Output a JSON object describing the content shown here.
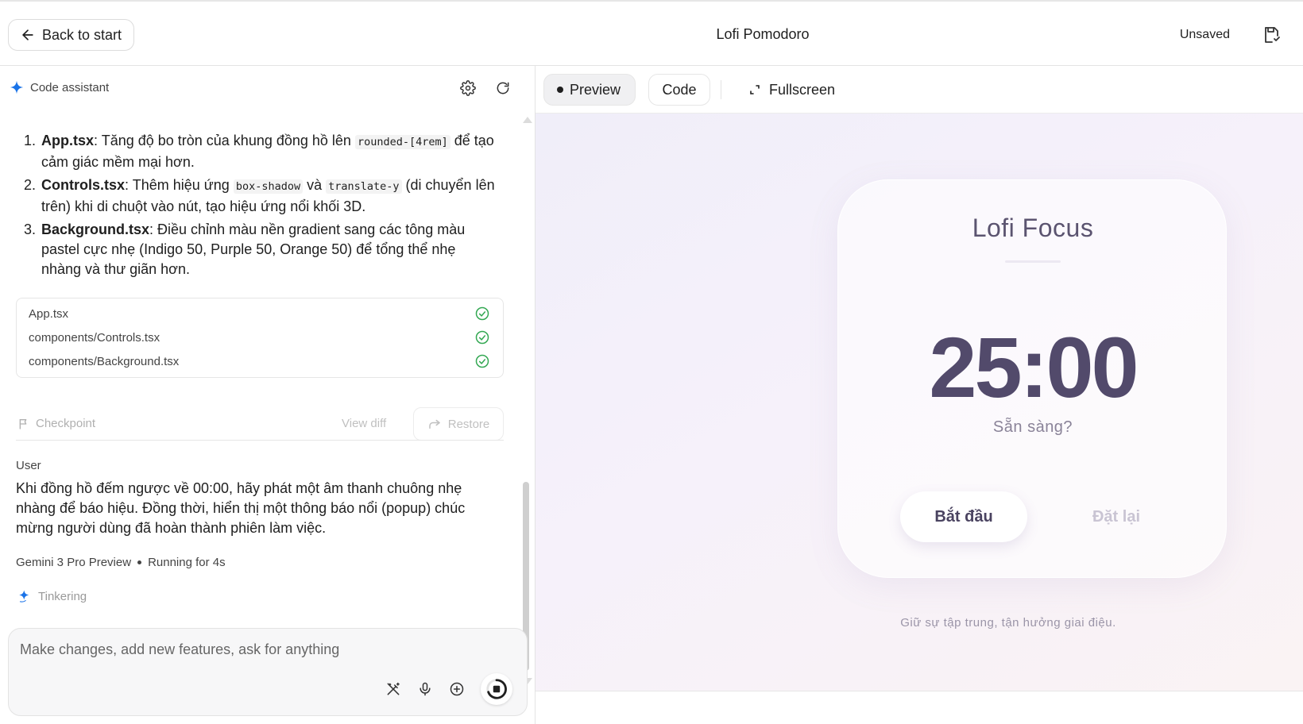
{
  "header": {
    "back_label": "Back to start",
    "title": "Lofi Pomodoro",
    "status": "Unsaved"
  },
  "assistant": {
    "title": "Code assistant",
    "changes": [
      {
        "file": "App.tsx",
        "pre": ": Tăng độ bo tròn của khung đồng hồ lên ",
        "code": "rounded-[4rem]",
        "post": " để tạo cảm giác mềm mại hơn."
      },
      {
        "file": "Controls.tsx",
        "pre": ": Thêm hiệu ứng ",
        "code": "box-shadow",
        "mid": " và ",
        "code2": "translate-y",
        "post": " (di chuyển lên trên) khi di chuột vào nút, tạo hiệu ứng nổi khối 3D."
      },
      {
        "file": "Background.tsx",
        "pre": ": Điều chỉnh màu nền gradient sang các tông màu pastel cực nhẹ (Indigo 50, Purple 50, Orange 50) để tổng thể nhẹ nhàng và thư giãn hơn."
      }
    ],
    "files": [
      "App.tsx",
      "components/Controls.tsx",
      "components/Background.tsx"
    ],
    "checkpoint_label": "Checkpoint",
    "view_diff_label": "View diff",
    "restore_label": "Restore",
    "user_label": "User",
    "user_message": "Khi đồng hồ đếm ngược về 00:00, hãy phát một âm thanh chuông nhẹ nhàng để báo hiệu. Đồng thời, hiển thị một thông báo nổi (popup) chúc mừng người dùng đã hoàn thành phiên làm việc.",
    "model_name": "Gemini 3 Pro Preview",
    "running_status": "Running for 4s",
    "tinkering_label": "Tinkering",
    "input_placeholder": "Make changes, add new features, ask for anything"
  },
  "preview_tabs": {
    "preview": "Preview",
    "code": "Code",
    "fullscreen": "Fullscreen"
  },
  "app_preview": {
    "title": "Lofi Focus",
    "timer": "25:00",
    "status": "Sẵn sàng?",
    "start_label": "Bắt đầu",
    "reset_label": "Đặt lại",
    "footer": "Giữ sự tập trung, tận hưởng giai điệu."
  },
  "colors": {
    "accent_blue": "#1a73e8",
    "success_green": "#34a853",
    "timer_text": "#524a6b"
  }
}
